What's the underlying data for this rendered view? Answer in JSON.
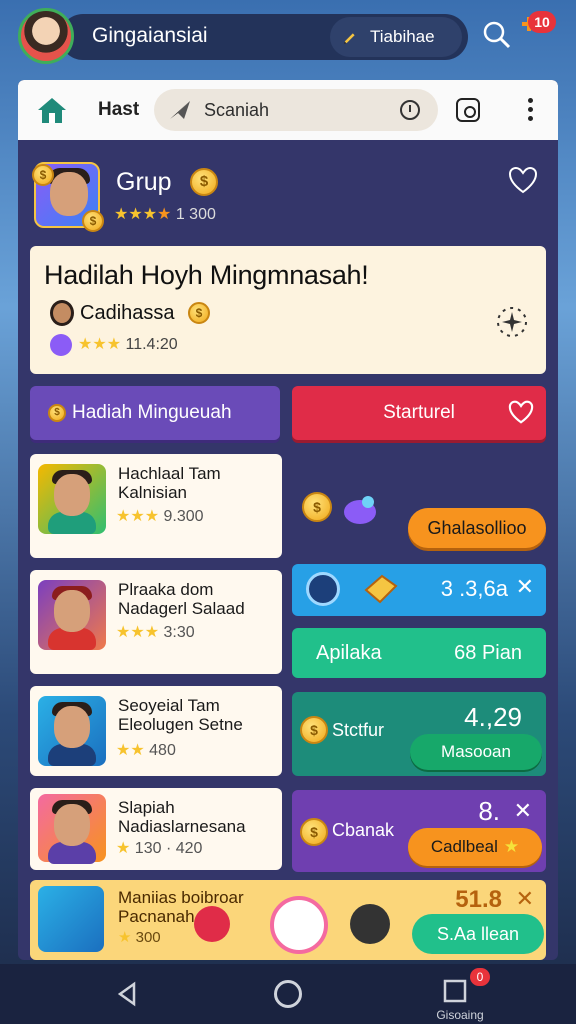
{
  "header": {
    "app_title": "Gingaiansiai",
    "mode_label": "Tiabihae",
    "notification_count": "10"
  },
  "navbar": {
    "label": "Hast",
    "search_placeholder": "Scaniah"
  },
  "group": {
    "title": "Grup",
    "rating_stars": "★★★",
    "rating_star_half": "★",
    "rating_value": "1 300"
  },
  "banner": {
    "title": "Hadilah Hoyh Mingmnasah!",
    "user_name": "Cadihassa",
    "meta": "11.4:20"
  },
  "actions": {
    "claim_label": "Hadiah Mingueuah",
    "start_label": "Starturel"
  },
  "list": [
    {
      "title": "Hachlaal Tam Kalnisian",
      "stars": "★★★",
      "value": "9.300"
    },
    {
      "title": "Plraaka dom Nadagerl Salaad",
      "stars": "★★★",
      "value": "3:30"
    },
    {
      "title": "Seoyeial Tam Eleolugen Setne",
      "stars": "★★",
      "value": "480"
    },
    {
      "title": "Slapiah Nadiaslarnesana",
      "stars": "★",
      "value": "130 · 420"
    },
    {
      "title": "Maniias boibroar Pacnanah",
      "stars": "★",
      "value": "300"
    }
  ],
  "right": {
    "orange_btn": "Ghalasollioo",
    "blue_value": "3 .3,6a",
    "green_left": "Apilaka",
    "green_right": "68 Pian",
    "teal_label": "Stctfur",
    "teal_value": "4.,29",
    "teal_btn": "Masooan",
    "purple_label": "Cbanak",
    "purple_value": "8.",
    "purple_btn": "Cadlbeal",
    "bottom_value": "51.8",
    "bottom_btn": "S.Aa llean"
  },
  "bottom_nav": {
    "recent_badge": "0",
    "caption": "Gisoaing"
  },
  "colors": {
    "accent_red": "#e02c48",
    "accent_purple": "#6a4bb8",
    "accent_orange": "#f7931e",
    "accent_green": "#21c08b",
    "accent_blue": "#27a0e6"
  }
}
